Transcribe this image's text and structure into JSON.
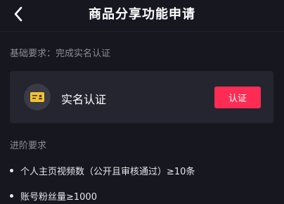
{
  "header": {
    "title": "商品分享功能申请"
  },
  "basic": {
    "heading": "基础要求：完成实名认证"
  },
  "card": {
    "title": "实名认证",
    "button_label": "认证"
  },
  "advanced": {
    "heading": "进阶要求",
    "items": [
      "个人主页视频数（公开且审核通过）≥10条",
      "账号粉丝量≥1000"
    ]
  },
  "colors": {
    "background": "#16171f",
    "card": "#24252f",
    "accent": "#fe2c55",
    "icon_yellow": "#f6c22e"
  },
  "icons": {
    "back": "chevron-left-icon",
    "id_card": "id-card-icon"
  }
}
